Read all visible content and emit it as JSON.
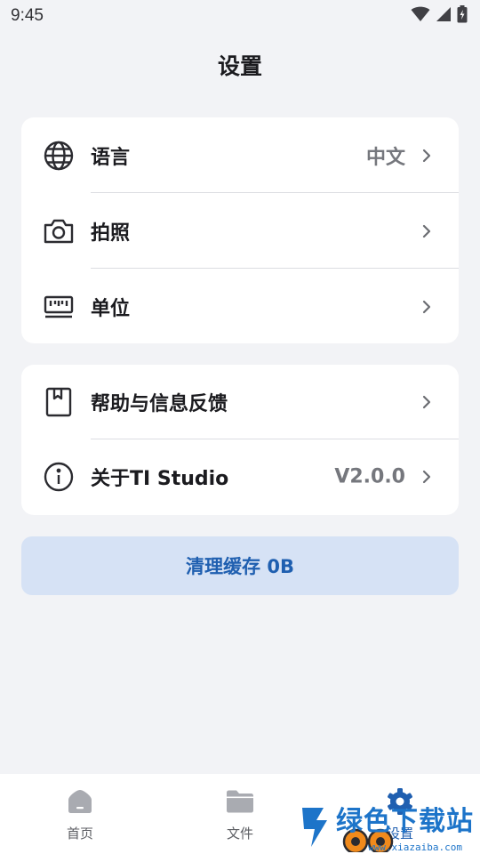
{
  "status_bar": {
    "time": "9:45",
    "icons": [
      "wifi-icon",
      "cell-signal-icon",
      "battery-icon"
    ]
  },
  "header": {
    "title": "设置"
  },
  "settings_group_1": [
    {
      "icon": "globe-icon",
      "label": "语言",
      "value": "中文"
    },
    {
      "icon": "camera-icon",
      "label": "拍照",
      "value": ""
    },
    {
      "icon": "ruler-icon",
      "label": "单位",
      "value": ""
    }
  ],
  "settings_group_2": [
    {
      "icon": "bookmark-icon",
      "label": "帮助与信息反馈",
      "value": ""
    },
    {
      "icon": "info-icon",
      "label": "关于TI Studio",
      "value": "V2.0.0"
    }
  ],
  "clear_cache": {
    "label": "清理缓存 0B"
  },
  "bottom_nav": {
    "items": [
      {
        "icon": "home-icon",
        "label": "首页",
        "active": false
      },
      {
        "icon": "folder-icon",
        "label": "文件",
        "active": false
      },
      {
        "icon": "gear-icon",
        "label": "设置",
        "active": true
      }
    ]
  },
  "watermark": {
    "text": "绿色下载站",
    "url": "www.xiazaiba.com"
  },
  "colors": {
    "background": "#f2f3f6",
    "card": "#ffffff",
    "accent": "#1f5fb0",
    "button_bg": "#d6e2f5",
    "secondary_text": "#75777d"
  }
}
